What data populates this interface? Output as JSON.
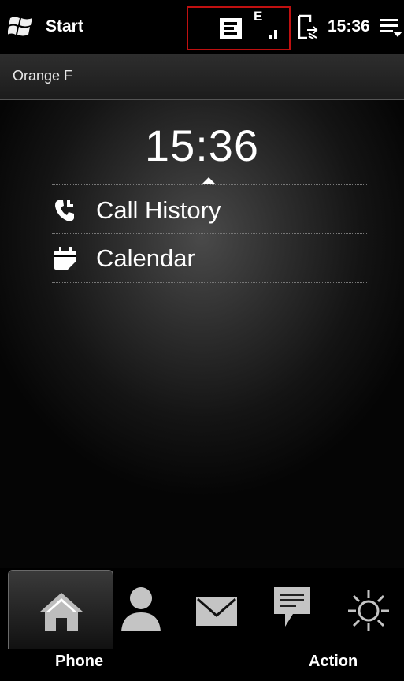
{
  "statusbar": {
    "start_label": "Start",
    "network_type": "E",
    "time": "15:36",
    "icons": [
      "windows-logo-icon",
      "storage-icon",
      "edge-signal-icon",
      "sync-icon",
      "menu-icon"
    ]
  },
  "operator": {
    "name": "Orange F"
  },
  "home": {
    "clock": "15:36",
    "items": [
      {
        "label": "Call History",
        "icon": "call-history-icon"
      },
      {
        "label": "Calendar",
        "icon": "calendar-icon"
      }
    ]
  },
  "tabs": [
    {
      "name": "home-tab",
      "icon": "home-icon",
      "selected": true
    },
    {
      "name": "contacts-tab",
      "icon": "person-icon",
      "selected": false
    },
    {
      "name": "messages-tab",
      "icon": "envelope-icon",
      "selected": false
    },
    {
      "name": "text-tab",
      "icon": "speech-bubble-icon",
      "selected": false
    },
    {
      "name": "settings-tab",
      "icon": "sun-gear-icon",
      "selected": false
    }
  ],
  "softkeys": {
    "left": "Phone",
    "right": "Action"
  },
  "colors": {
    "highlight_border": "#c01010",
    "background": "#000000",
    "text": "#ffffff",
    "icon_gray": "#b8b8b8"
  }
}
